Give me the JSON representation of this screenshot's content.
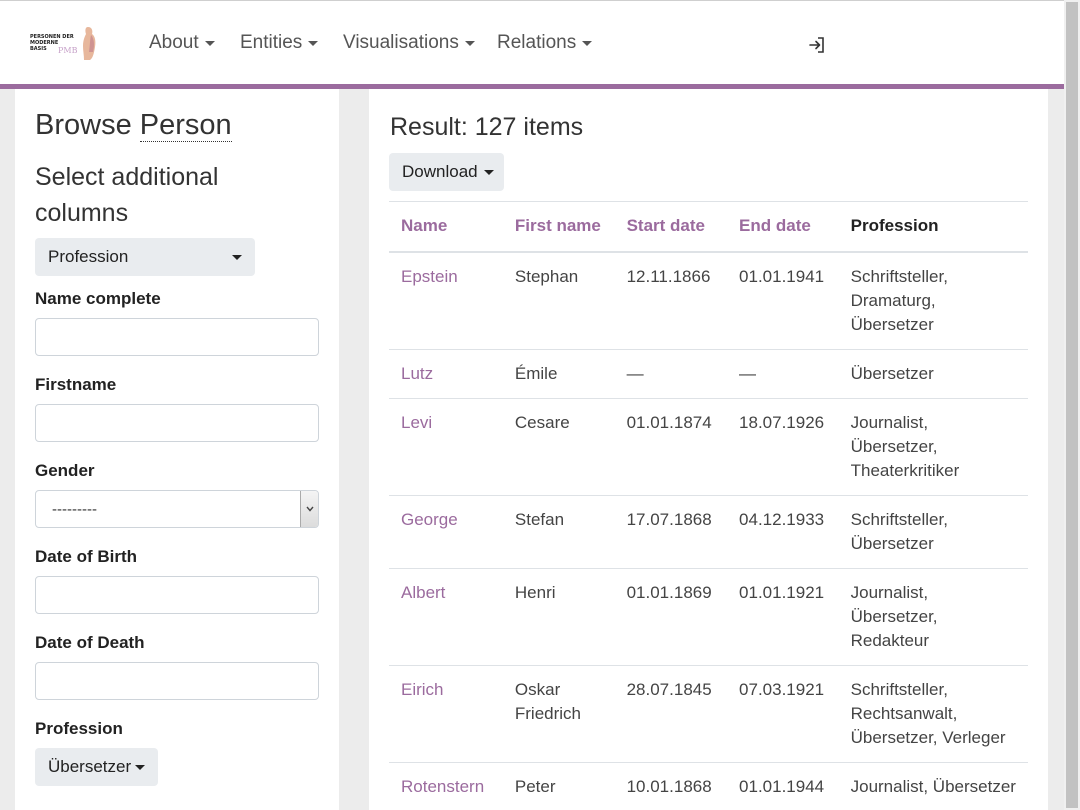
{
  "navbar": {
    "logo": {
      "line1": "PERSONEN DER",
      "line2": "MODERNE",
      "line3": "BASIS",
      "mark": "PMB"
    },
    "items": [
      {
        "label": "About"
      },
      {
        "label": "Entities"
      },
      {
        "label": "Visualisations"
      },
      {
        "label": "Relations"
      }
    ],
    "login_icon": "sign-in-icon",
    "accent_color": "#9b6b9e"
  },
  "sidebar": {
    "title_prefix": "Browse ",
    "title_entity": "Person",
    "subtitle": "Select additional columns",
    "columns_button": "Profession",
    "fields": {
      "name_complete": {
        "label": "Name complete",
        "value": ""
      },
      "firstname": {
        "label": "Firstname",
        "value": ""
      },
      "gender": {
        "label": "Gender",
        "value": "---------"
      },
      "date_of_birth": {
        "label": "Date of Birth",
        "value": ""
      },
      "date_of_death": {
        "label": "Date of Death",
        "value": ""
      },
      "profession": {
        "label": "Profession",
        "value": "Übersetzer"
      }
    }
  },
  "results": {
    "title": "Result: 127 items",
    "download_label": "Download",
    "columns": [
      "Name",
      "First name",
      "Start date",
      "End date",
      "Profession"
    ],
    "rows": [
      {
        "name": "Epstein",
        "first_name": "Stephan",
        "start": "12.11.1866",
        "end": "01.01.1941",
        "profession": [
          "Schriftsteller,",
          "Dramaturg,",
          "Übersetzer"
        ]
      },
      {
        "name": "Lutz",
        "first_name": "Émile",
        "start": "—",
        "end": "—",
        "profession": [
          "Übersetzer"
        ]
      },
      {
        "name": "Levi",
        "first_name": "Cesare",
        "start": "01.01.1874",
        "end": "18.07.1926",
        "profession": [
          "Journalist,",
          "Übersetzer,",
          "Theaterkritiker"
        ]
      },
      {
        "name": "George",
        "first_name": "Stefan",
        "start": "17.07.1868",
        "end": "04.12.1933",
        "profession": [
          "Schriftsteller,",
          "Übersetzer"
        ]
      },
      {
        "name": "Albert",
        "first_name": "Henri",
        "start": "01.01.1869",
        "end": "01.01.1921",
        "profession": [
          "Journalist,",
          "Übersetzer,",
          "Redakteur"
        ]
      },
      {
        "name": "Eirich",
        "first_name": "Oskar Friedrich",
        "start": "28.07.1845",
        "end": "07.03.1921",
        "profession": [
          "Schriftsteller,",
          "Rechtsanwalt,",
          "Übersetzer, Verleger"
        ]
      },
      {
        "name": "Rotenstern",
        "first_name": "Peter",
        "start": "10.01.1868",
        "end": "01.01.1944",
        "profession": [
          "Journalist, Übersetzer"
        ]
      }
    ]
  }
}
